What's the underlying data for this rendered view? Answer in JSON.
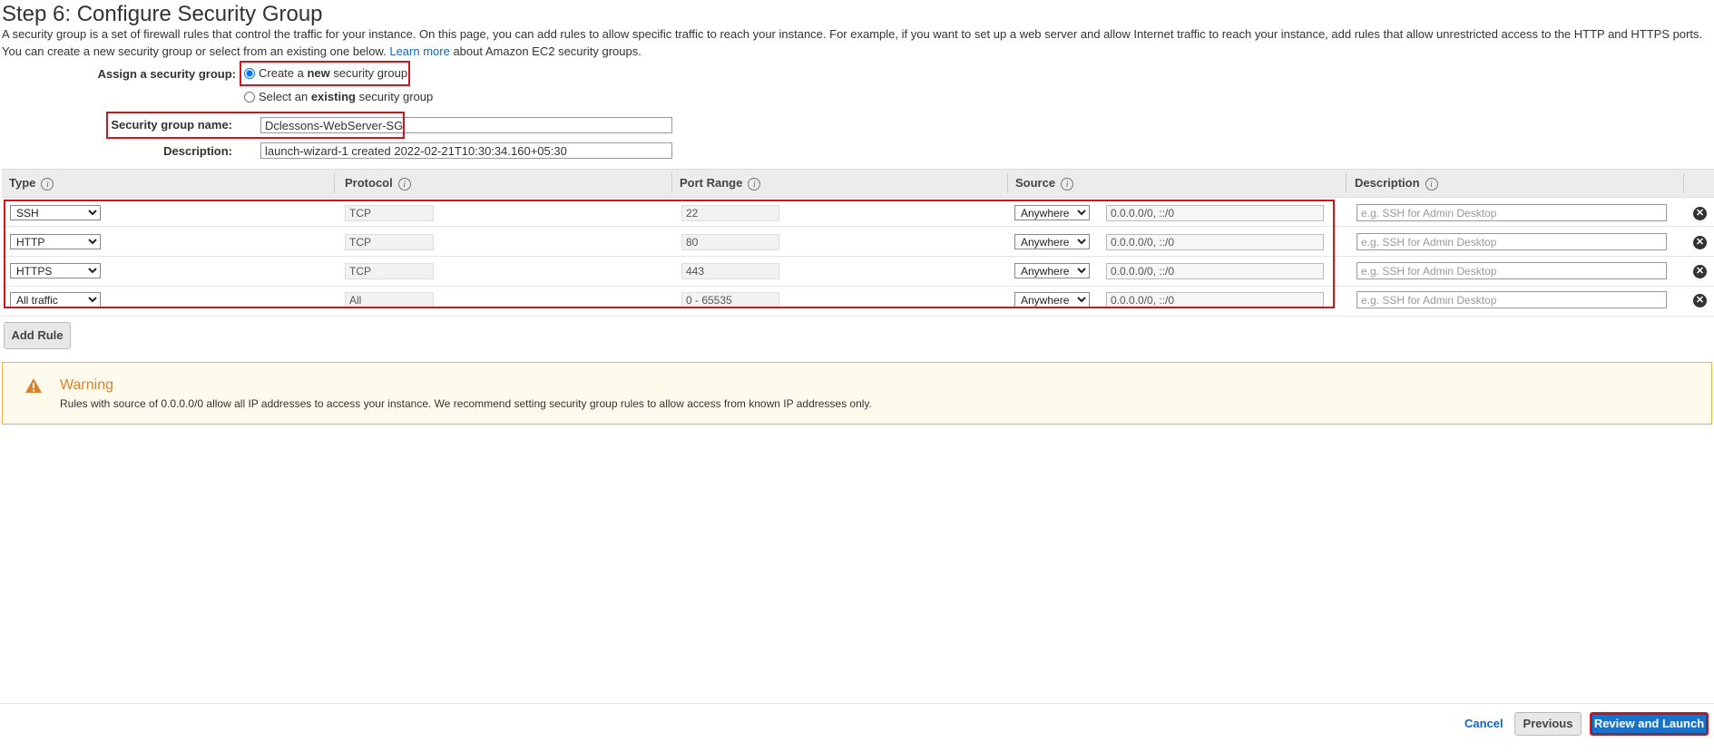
{
  "page": {
    "title": "Step 6: Configure Security Group",
    "intro_text": "A security group is a set of firewall rules that control the traffic for your instance. On this page, you can add rules to allow specific traffic to reach your instance. For example, if you want to set up a web server and allow Internet traffic to reach your instance, add rules that allow unrestricted access to the HTTP and HTTPS ports. You can create a new security group or select from an existing one below.",
    "learn_more": "Learn more",
    "intro_suffix": "about Amazon EC2 security groups."
  },
  "assign": {
    "label": "Assign a security group:",
    "option_new_prefix": "Create a ",
    "option_new_bold": "new",
    "option_new_suffix": " security group",
    "option_existing_prefix": "Select an ",
    "option_existing_bold": "existing",
    "option_existing_suffix": " security group",
    "selected": "new"
  },
  "group": {
    "name_label": "Security group name:",
    "name_value": "Dclessons-WebServer-SG",
    "description_label": "Description:",
    "description_value": "launch-wizard-1 created 2022-02-21T10:30:34.160+05:30"
  },
  "table": {
    "headers": {
      "type": "Type",
      "protocol": "Protocol",
      "port_range": "Port Range",
      "source": "Source",
      "description": "Description"
    },
    "info_glyph": "i",
    "rules": [
      {
        "type": "SSH",
        "protocol": "TCP",
        "port": "22",
        "source_type": "Anywhere",
        "source_cidr": "0.0.0.0/0, ::/0",
        "desc_placeholder": "e.g. SSH for Admin Desktop"
      },
      {
        "type": "HTTP",
        "protocol": "TCP",
        "port": "80",
        "source_type": "Anywhere",
        "source_cidr": "0.0.0.0/0, ::/0",
        "desc_placeholder": "e.g. SSH for Admin Desktop"
      },
      {
        "type": "HTTPS",
        "protocol": "TCP",
        "port": "443",
        "source_type": "Anywhere",
        "source_cidr": "0.0.0.0/0, ::/0",
        "desc_placeholder": "e.g. SSH for Admin Desktop"
      },
      {
        "type": "All traffic",
        "protocol": "All",
        "port": "0 - 65535",
        "source_type": "Anywhere",
        "source_cidr": "0.0.0.0/0, ::/0",
        "desc_placeholder": "e.g. SSH for Admin Desktop"
      }
    ],
    "remove_glyph": "✕"
  },
  "buttons": {
    "add_rule": "Add Rule",
    "cancel": "Cancel",
    "previous": "Previous",
    "review_launch": "Review and Launch"
  },
  "warning": {
    "title": "Warning",
    "text": "Rules with source of 0.0.0.0/0 allow all IP addresses to access your instance. We recommend setting security group rules to allow access from known IP addresses only.",
    "icon": "warning-triangle-icon",
    "color": "#d9822b"
  },
  "colors": {
    "highlight": "#d0141c",
    "primary": "#1a73c9",
    "link": "#1166bb"
  }
}
